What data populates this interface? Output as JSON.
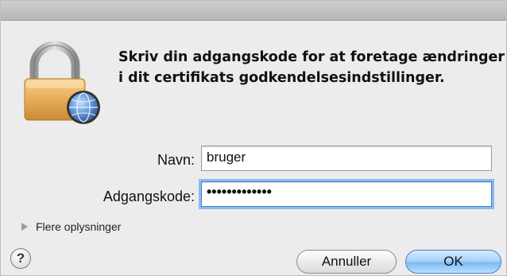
{
  "dialog": {
    "message_line1": "Skriv din adgangskode for at foretage ændringer",
    "message_line2": "i dit certifikats godkendelsesindstillinger."
  },
  "form": {
    "name_label": "Navn:",
    "name_value": "bruger",
    "password_label": "Adgangskode:",
    "password_value": "•••••••••••••"
  },
  "details": {
    "label": "Flere oplysninger"
  },
  "buttons": {
    "help": "?",
    "cancel": "Annuller",
    "ok": "OK"
  },
  "icons": {
    "lock": "padlock-icon",
    "globe": "network-globe-icon",
    "disclosure": "disclosure-triangle-icon"
  },
  "colors": {
    "window_bg": "#ececec",
    "focus_ring": "#8fb9ef",
    "default_button": "#7fbaf4"
  }
}
